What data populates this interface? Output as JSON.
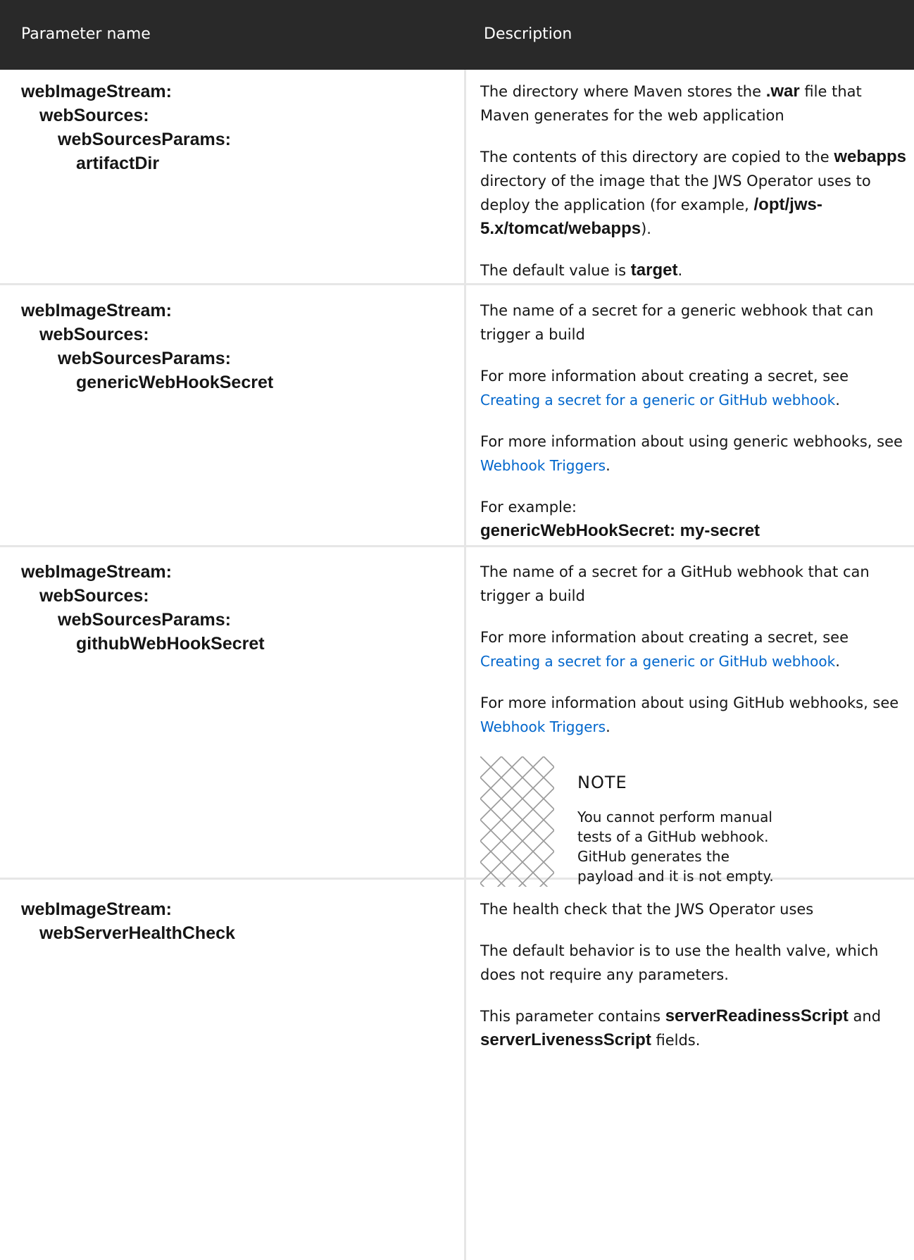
{
  "header": {
    "col_param": "Parameter name",
    "col_desc": "Description"
  },
  "rows": [
    {
      "param": [
        "webImageStream:",
        "webSources:",
        "webSourcesParams:",
        "artifactDir"
      ],
      "desc": {
        "p1_a": "The directory where Maven stores the ",
        "p1_b": ".war",
        "p1_c": " file that Maven generates for the web application",
        "p2_a": "The contents of this directory are copied to the ",
        "p2_b": "webapps",
        "p2_c": " directory of the image that the JWS Operator uses to deploy the application (for example, ",
        "p2_d": "/opt/jws-5.x/tomcat/webapps",
        "p2_e": ").",
        "p3_a": "The default value is ",
        "p3_b": "target",
        "p3_c": "."
      }
    },
    {
      "param": [
        "webImageStream:",
        "webSources:",
        "webSourcesParams:",
        "genericWebHookSecret"
      ],
      "desc": {
        "p1": "The name of a secret for a generic webhook that can trigger a build",
        "p2_a": "For more information about creating a secret, see ",
        "p2_link": "Creating a secret for a generic or GitHub webhook",
        "p2_end": ".",
        "p3_a": "For more information about using generic webhooks, see ",
        "p3_link": "Webhook Triggers",
        "p3_end": ".",
        "p4_a": "For example:",
        "p4_code": "genericWebHookSecret: my-secret"
      }
    },
    {
      "param": [
        "webImageStream:",
        "webSources:",
        "webSourcesParams:",
        "githubWebHookSecret"
      ],
      "desc": {
        "p1": "The name of a secret for a GitHub webhook that can trigger a build",
        "p2_a": "For more information about creating a secret, see ",
        "p2_link": "Creating a secret for a generic or GitHub webhook",
        "p2_end": ".",
        "p3_a": "For more information about using GitHub webhooks, see ",
        "p3_link": "Webhook Triggers",
        "p3_end": ".",
        "note_title": "NOTE",
        "note_text": "You cannot perform manual tests of a GitHub webhook. GitHub generates the payload and it is not empty."
      }
    },
    {
      "param": [
        "webImageStream:",
        "webServerHealthCheck"
      ],
      "desc": {
        "p1": "The health check that the JWS Operator uses",
        "p2": "The default behavior is to use the health valve, which does not require any parameters.",
        "p3_a": "This parameter contains ",
        "p3_b": "serverReadinessScript",
        "p3_c": " and ",
        "p3_d": "serverLivenessScript",
        "p3_e": " fields."
      }
    }
  ]
}
